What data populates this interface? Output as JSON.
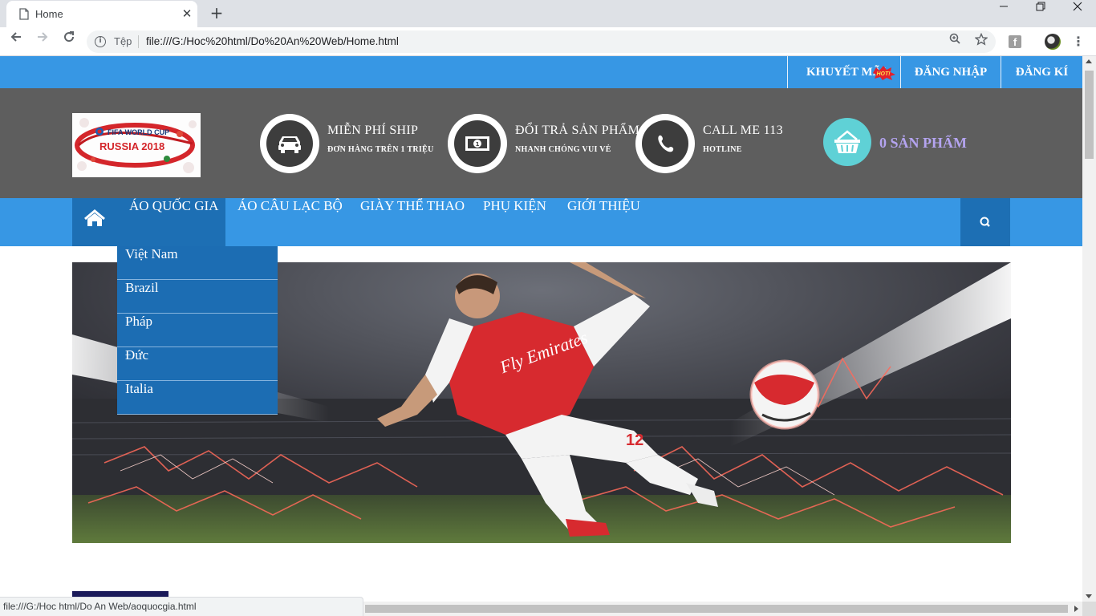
{
  "browser": {
    "tab_title": "Home",
    "tab_close": "✕",
    "new_tab": "+",
    "secure_label": "Tệp",
    "url": "file:///G:/Hoc%20html/Do%20An%20Web/Home.html",
    "status_url": "file:///G:/Hoc html/Do An Web/aoquocgia.html"
  },
  "topbar": {
    "promo": "KHUYẾT MÃI",
    "login": "ĐĂNG NHẬP",
    "register": "ĐĂNG KÍ",
    "hot_badge": "HOT!"
  },
  "header": {
    "logo_line1": "FIFA WORLD CUP",
    "logo_line2": "RUSSIA 2018",
    "features": [
      {
        "title": "MIỄN PHÍ SHIP",
        "sub": "ĐƠN HÀNG TRÊN 1 TRIỆU",
        "icon": "car-icon"
      },
      {
        "title": "ĐỔI TRẢ SẢN PHẨM",
        "sub": "NHANH CHÓNG VUI VẺ",
        "icon": "money-icon"
      },
      {
        "title": "CALL ME 113",
        "sub": "HOTLINE",
        "icon": "phone-icon"
      }
    ],
    "cart_label": "0 SẢN PHẨM"
  },
  "nav": {
    "items": [
      "ÁO QUỐC GIA",
      "ÁO CÂU LẠC BỘ",
      "GIÀY THỂ THAO",
      "PHỤ KIỆN",
      "GIỚI THIỆU"
    ],
    "dropdown": [
      "Việt Nam",
      "Brazil",
      "Pháp",
      "Đức",
      "Italia"
    ]
  },
  "banner": {
    "jersey_text": "Fly Emirates",
    "number": "12"
  },
  "colors": {
    "primary_blue": "#3797e4",
    "dark_blue": "#1d6fb4",
    "header_gray": "#5e5e5e",
    "cart_teal": "#5fd1d6",
    "cart_text": "#b4a4f0"
  }
}
